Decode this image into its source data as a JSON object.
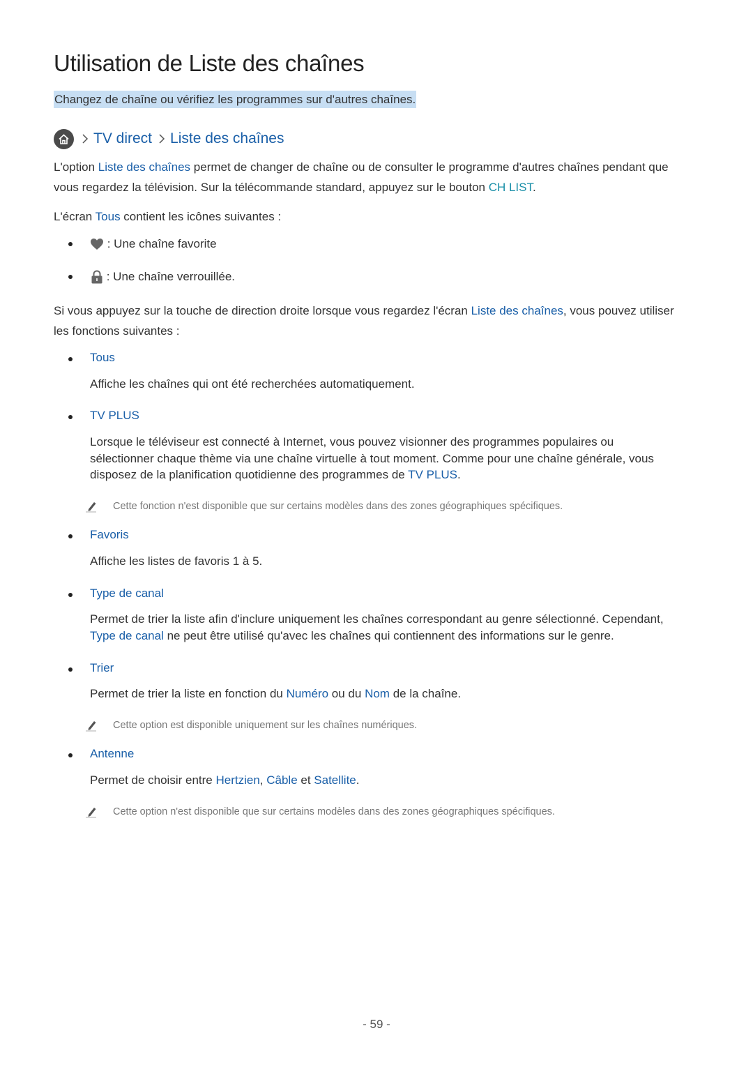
{
  "page": {
    "title": "Utilisation de Liste des chaînes",
    "subtitle": "Changez de chaîne ou vérifiez les programmes sur d'autres chaînes.",
    "breadcrumb": {
      "home_icon": "home-icon",
      "items": [
        "TV direct",
        "Liste des chaînes"
      ]
    },
    "intro": {
      "line1_pre": "L'option ",
      "line1_link": "Liste des chaînes",
      "line1_post": " permet de changer de chaîne ou de consulter le programme d'autres chaînes pendant que",
      "line2_pre": "vous regardez la télévision. Sur la télécommande standard, appuyez sur le bouton ",
      "line2_key": "CH LIST",
      "line2_post": "."
    },
    "icons_intro": {
      "pre": "L'écran ",
      "link": "Tous",
      "post": " contient les icônes suivantes :"
    },
    "icon_list": [
      {
        "icon": "heart-icon",
        "text": " : Une chaîne favorite"
      },
      {
        "icon": "lock-icon",
        "text": " : Une chaîne verrouillée."
      }
    ],
    "functions_intro": {
      "line1_pre": "Si vous appuyez sur la touche de direction droite lorsque vous regardez l'écran ",
      "line1_link": "Liste des chaînes",
      "line1_post": ", vous pouvez utiliser",
      "line2": "les fonctions suivantes :"
    },
    "functions": {
      "tous": {
        "title": "Tous",
        "desc": "Affiche les chaînes qui ont été recherchées automatiquement."
      },
      "tvplus": {
        "title": "TV PLUS",
        "desc1": "Lorsque le téléviseur est connecté à Internet, vous pouvez visionner des programmes populaires ou",
        "desc2": "sélectionner chaque thème via une chaîne virtuelle à tout moment. Comme pour une chaîne générale, vous",
        "desc3_pre": "disposez de la planification quotidienne des programmes de ",
        "desc3_link": "TV PLUS",
        "desc3_post": ".",
        "note": "Cette fonction n'est disponible que sur certains modèles dans des zones géographiques spécifiques."
      },
      "favoris": {
        "title": "Favoris",
        "desc": "Affiche les listes de favoris 1 à 5."
      },
      "type": {
        "title": "Type de canal",
        "desc1": "Permet de trier la liste afin d'inclure uniquement les chaînes correspondant au genre sélectionné. Cependant,",
        "desc2_link": "Type de canal",
        "desc2_post": " ne peut être utilisé qu'avec les chaînes qui contiennent des informations sur le genre."
      },
      "trier": {
        "title": "Trier",
        "desc_pre": "Permet de trier la liste en fonction du ",
        "desc_link1": "Numéro",
        "desc_mid": " ou du ",
        "desc_link2": "Nom",
        "desc_post": " de la chaîne.",
        "note": "Cette option est disponible uniquement sur les chaînes numériques."
      },
      "antenne": {
        "title": "Antenne",
        "desc_pre": "Permet de choisir entre ",
        "desc_link1": "Hertzien",
        "desc_sep": ", ",
        "desc_link2": "Câble",
        "desc_mid": " et ",
        "desc_link3": "Satellite",
        "desc_post": ".",
        "note": "Cette option n'est disponible que sur certains modèles dans des zones géographiques spécifiques."
      }
    },
    "page_number": "- 59 -"
  },
  "colors": {
    "link_blue": "#1a5fa8",
    "key_teal": "#1a8fa8",
    "highlight": "#c7def3",
    "note_gray": "#777777"
  }
}
